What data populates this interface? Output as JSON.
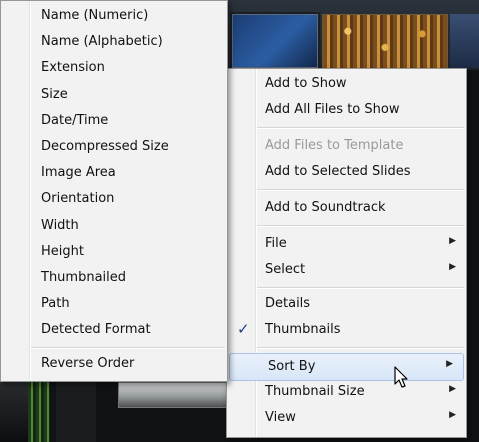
{
  "sort_submenu": {
    "items": [
      {
        "label": "Name (Numeric)"
      },
      {
        "label": "Name (Alphabetic)"
      },
      {
        "label": "Extension"
      },
      {
        "label": "Size"
      },
      {
        "label": "Date/Time"
      },
      {
        "label": "Decompressed Size"
      },
      {
        "label": "Image Area"
      },
      {
        "label": "Orientation"
      },
      {
        "label": "Width"
      },
      {
        "label": "Height"
      },
      {
        "label": "Thumbnailed"
      },
      {
        "label": "Path"
      },
      {
        "label": "Detected Format"
      }
    ],
    "reverse_order": "Reverse Order"
  },
  "context_menu": {
    "add_to_show": "Add to Show",
    "add_all_files_to_show": "Add All Files to Show",
    "add_files_to_template": "Add Files to Template",
    "add_to_selected_slides": "Add to Selected Slides",
    "add_to_soundtrack": "Add to Soundtrack",
    "file": "File",
    "select": "Select",
    "details": "Details",
    "thumbnails": "Thumbnails",
    "sort_by": "Sort By",
    "thumbnail_size": "Thumbnail Size",
    "view": "View",
    "checkmark": "✓",
    "submenu_arrow": "▶"
  }
}
